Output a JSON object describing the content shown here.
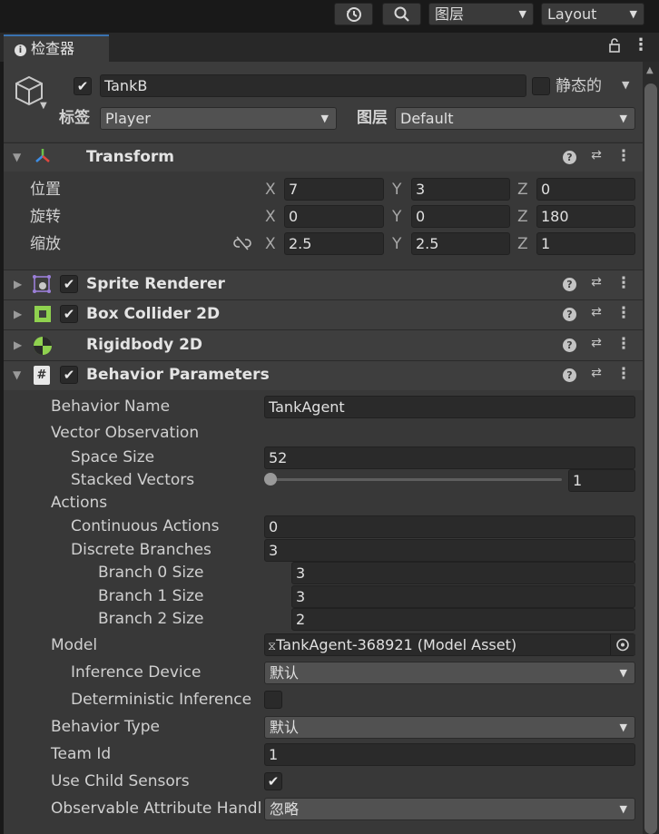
{
  "toolbar": {
    "history_icon": "history-icon",
    "search_icon": "search-icon",
    "layers_label": "图层",
    "layout_label": "Layout"
  },
  "tab": {
    "title": "检查器"
  },
  "object": {
    "name": "TankB",
    "active": true,
    "static_label": "静态的",
    "tag_label": "标签",
    "tag_value": "Player",
    "layer_label": "图层",
    "layer_value": "Default"
  },
  "transform": {
    "title": "Transform",
    "rows": [
      {
        "label": "位置",
        "x": "7",
        "y": "3",
        "z": "0"
      },
      {
        "label": "旋转",
        "x": "0",
        "y": "0",
        "z": "180"
      },
      {
        "label": "缩放",
        "x": "2.5",
        "y": "2.5",
        "z": "1"
      }
    ],
    "axes": {
      "x": "X",
      "y": "Y",
      "z": "Z"
    }
  },
  "components": [
    {
      "title": "Sprite Renderer",
      "enabled": true
    },
    {
      "title": "Box Collider 2D",
      "enabled": true
    },
    {
      "title": "Rigidbody 2D",
      "enabled": null
    },
    {
      "title": "Behavior Parameters",
      "enabled": true
    }
  ],
  "behavior": {
    "behavior_name_label": "Behavior Name",
    "behavior_name_value": "TankAgent",
    "vector_observation_label": "Vector Observation",
    "space_size_label": "Space Size",
    "space_size_value": "52",
    "stacked_vectors_label": "Stacked Vectors",
    "stacked_vectors_value": "1",
    "stacked_vectors_fraction": 0.0,
    "actions_label": "Actions",
    "continuous_actions_label": "Continuous Actions",
    "continuous_actions_value": "0",
    "discrete_branches_label": "Discrete Branches",
    "discrete_branches_value": "3",
    "branches": [
      {
        "label": "Branch 0 Size",
        "value": "3"
      },
      {
        "label": "Branch 1 Size",
        "value": "3"
      },
      {
        "label": "Branch 2 Size",
        "value": "2"
      }
    ],
    "model_label": "Model",
    "model_value": "TankAgent-368921 (Model Asset)",
    "inference_device_label": "Inference Device",
    "inference_device_value": "默认",
    "deterministic_inference_label": "Deterministic Inference",
    "deterministic_inference_checked": false,
    "behavior_type_label": "Behavior Type",
    "behavior_type_value": "默认",
    "team_id_label": "Team Id",
    "team_id_value": "1",
    "use_child_sensors_label": "Use Child Sensors",
    "use_child_sensors_checked": true,
    "observable_attribute_label": "Observable Attribute Handl",
    "observable_attribute_value": "忽略"
  },
  "colors": {
    "accent": "#3a72b0",
    "panel": "#383838",
    "field": "#2a2a2a"
  }
}
